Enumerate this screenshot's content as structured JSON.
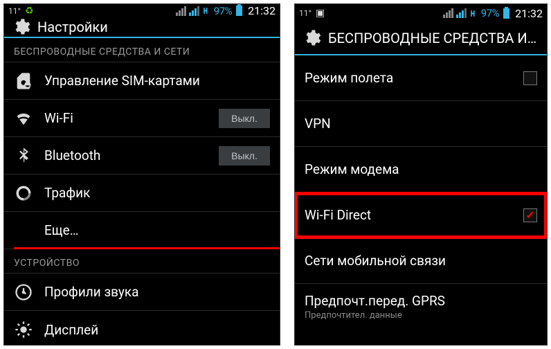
{
  "left": {
    "statusbar": {
      "temp": "11°",
      "battery": "97%",
      "time": "21:32"
    },
    "actionbar": {
      "title": "Настройки"
    },
    "section_wireless": "БЕСПРОВОДНЫЕ СРЕДСТВА И СЕТИ",
    "items": {
      "sim": "Управление SIM-картами",
      "wifi": "Wi-Fi",
      "wifi_toggle": "Выкл.",
      "bt": "Bluetooth",
      "bt_toggle": "Выкл.",
      "traffic": "Трафик",
      "more": "Еще…"
    },
    "section_device": "УСТРОЙСТВО",
    "device": {
      "sound": "Профили звука",
      "display": "Дисплей"
    }
  },
  "right": {
    "statusbar": {
      "temp": "11°",
      "battery": "97%",
      "time": "21:32"
    },
    "actionbar": {
      "title": "БЕСПРОВОДНЫЕ СРЕДСТВА И СЕ…"
    },
    "items": {
      "airplane": "Режим полета",
      "vpn": "VPN",
      "tether": "Режим модема",
      "wfd": "Wi-Fi Direct",
      "mobile": "Сети мобильной связи",
      "gprs": "Предпочт.перед. GPRS",
      "gprs_sub": "Предпочтител. данные"
    }
  }
}
